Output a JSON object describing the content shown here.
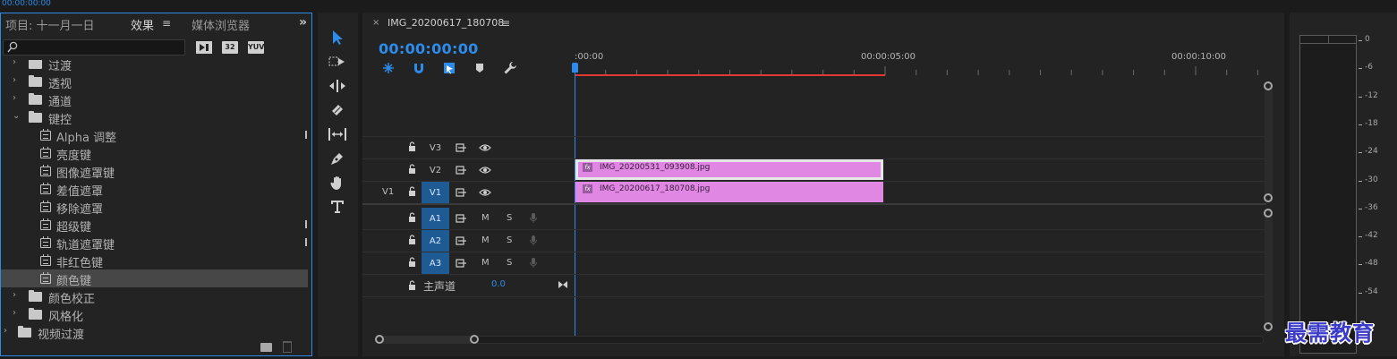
{
  "top_strip_time": "00:00:00:00",
  "effects_panel": {
    "tab_project": "项目: 十一月一日",
    "tab_effects": "效果",
    "tab_media": "媒体浏览器",
    "more": "»",
    "menu": "≡",
    "buttons": [
      "32",
      "YUV"
    ],
    "tree": [
      {
        "label": "过渡",
        "type": "folder",
        "expanded": false
      },
      {
        "label": "透视",
        "type": "folder",
        "expanded": false
      },
      {
        "label": "通道",
        "type": "folder",
        "expanded": false
      },
      {
        "label": "键控",
        "type": "folder",
        "expanded": true
      },
      {
        "label": "Alpha 调整",
        "type": "effect"
      },
      {
        "label": "亮度键",
        "type": "effect"
      },
      {
        "label": "图像遮罩键",
        "type": "effect"
      },
      {
        "label": "差值遮罩",
        "type": "effect"
      },
      {
        "label": "移除遮罩",
        "type": "effect"
      },
      {
        "label": "超级键",
        "type": "effect"
      },
      {
        "label": "轨道遮罩键",
        "type": "effect"
      },
      {
        "label": "非红色键",
        "type": "effect"
      },
      {
        "label": "颜色键",
        "type": "effect",
        "selected": true
      },
      {
        "label": "颜色校正",
        "type": "folder",
        "expanded": false
      },
      {
        "label": "风格化",
        "type": "folder",
        "expanded": false
      },
      {
        "label": "视频过渡",
        "type": "folder",
        "expanded": false
      }
    ]
  },
  "timeline": {
    "close": "×",
    "sequence_name": "IMG_20200617_180708",
    "menu": "≡",
    "timecode": "00:00:00:00",
    "ruler": [
      ":00:00",
      "00:00:05:00",
      "00:00:10:00"
    ],
    "video_tracks": [
      {
        "name": "V3",
        "source": ""
      },
      {
        "name": "V2",
        "source": ""
      },
      {
        "name": "V1",
        "source": "V1"
      }
    ],
    "audio_tracks": [
      {
        "name": "A1",
        "m": "M",
        "s": "S"
      },
      {
        "name": "A2",
        "m": "M",
        "s": "S"
      },
      {
        "name": "A3",
        "m": "M",
        "s": "S"
      }
    ],
    "master": {
      "label": "主声道",
      "value": "0.0"
    },
    "clips": {
      "v2": {
        "name": "IMG_20200531_093908.jpg",
        "fx": "fx"
      },
      "v1": {
        "name": "IMG_20200617_180708.jpg",
        "fx": "fx"
      }
    }
  },
  "meters": {
    "db_labels": [
      "0",
      "-6",
      "-12",
      "-18",
      "-24",
      "-30",
      "-36",
      "-42",
      "-48",
      "-54"
    ]
  },
  "watermark": "最需教育",
  "colors": {
    "accent": "#2d8ceb",
    "clip": "#e086e3",
    "work_area": "#e3382f",
    "track_target": "#1e5a94"
  }
}
